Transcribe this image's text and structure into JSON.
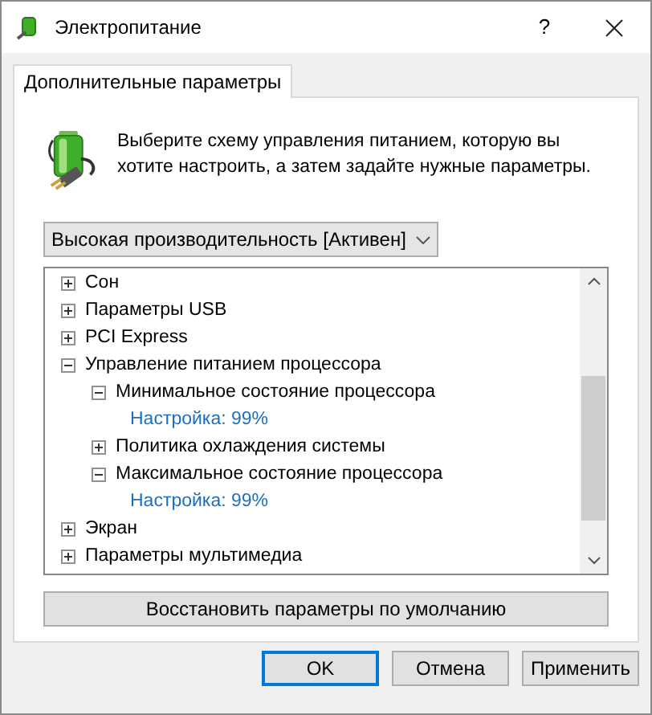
{
  "window": {
    "title": "Электропитание",
    "help": "?"
  },
  "tabs": [
    {
      "label": "Дополнительные параметры",
      "selected": true
    }
  ],
  "intro": "Выберите схему управления питанием, которую вы хотите настроить, а затем задайте нужные параметры.",
  "plan_dropdown": {
    "value": "Высокая производительность [Активен]"
  },
  "tree": [
    {
      "kind": "group",
      "label": "Сон",
      "expanded": false
    },
    {
      "kind": "group",
      "label": "Параметры USB",
      "expanded": false
    },
    {
      "kind": "group",
      "label": "PCI Express",
      "expanded": false
    },
    {
      "kind": "group",
      "label": "Управление питанием процессора",
      "expanded": true,
      "children": [
        {
          "kind": "group",
          "label": "Минимальное состояние процессора",
          "expanded": true,
          "children": [
            {
              "kind": "setting",
              "label": "Настройка: 99%"
            }
          ]
        },
        {
          "kind": "group",
          "label": "Политика охлаждения системы",
          "expanded": false
        },
        {
          "kind": "group",
          "label": "Максимальное состояние процессора",
          "expanded": true,
          "children": [
            {
              "kind": "setting",
              "label": "Настройка: 99%"
            }
          ]
        }
      ]
    },
    {
      "kind": "group",
      "label": "Экран",
      "expanded": false
    },
    {
      "kind": "group",
      "label": "Параметры мультимедиа",
      "expanded": false
    }
  ],
  "restore_button": "Восстановить параметры по умолчанию",
  "buttons": [
    {
      "label": "OK",
      "selected": true
    },
    {
      "label": "Отмена",
      "selected": false
    },
    {
      "label": "Применить",
      "selected": false
    }
  ]
}
